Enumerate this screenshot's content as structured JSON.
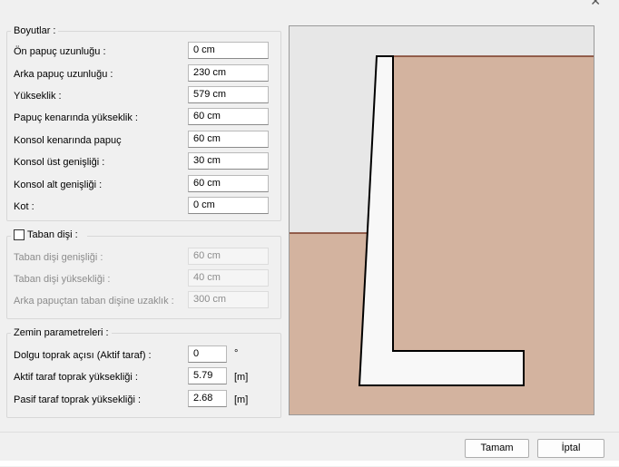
{
  "dims_group": {
    "title": "Boyutlar :",
    "rows": [
      {
        "label": "Ön papuç uzunluğu :",
        "value": "0 cm"
      },
      {
        "label": "Arka papuç uzunluğu :",
        "value": "230 cm"
      },
      {
        "label": "Yükseklik :",
        "value": "579 cm"
      },
      {
        "label": "Papuç kenarında yükseklik :",
        "value": "60 cm"
      },
      {
        "label": "Konsol kenarında papuç",
        "value": "60 cm"
      },
      {
        "label": "Konsol üst genişliği :",
        "value": "30 cm"
      },
      {
        "label": "Konsol alt genişliği :",
        "value": "60 cm"
      },
      {
        "label": "Kot :",
        "value": "0 cm"
      }
    ]
  },
  "heel_group": {
    "title": "Taban dişi :",
    "checked": false,
    "rows": [
      {
        "label": "Taban dişi genişliği :",
        "value": "60 cm"
      },
      {
        "label": "Taban dişi yüksekliği :",
        "value": "40 cm"
      },
      {
        "label": "Arka papuçtan taban dişine uzaklık :",
        "value": "300 cm"
      }
    ]
  },
  "soil_group": {
    "title": "Zemin parametreleri :",
    "rows": [
      {
        "label": "Dolgu toprak açısı (Aktif taraf) :",
        "value": "0",
        "unit": "°"
      },
      {
        "label": "Aktif taraf toprak yüksekliği :",
        "value": "5.79",
        "unit": "[m]"
      },
      {
        "label": "Pasif taraf toprak yüksekliği :",
        "value": "2.68",
        "unit": "[m]"
      }
    ]
  },
  "buttons": {
    "ok": "Tamam",
    "cancel": "İptal"
  },
  "icons": {
    "close": "close-icon"
  },
  "colors": {
    "soil": "#d3b39f",
    "soil_line": "#7a3a26",
    "sky": "#e7e7e7",
    "wall": "#f8f8f8"
  }
}
